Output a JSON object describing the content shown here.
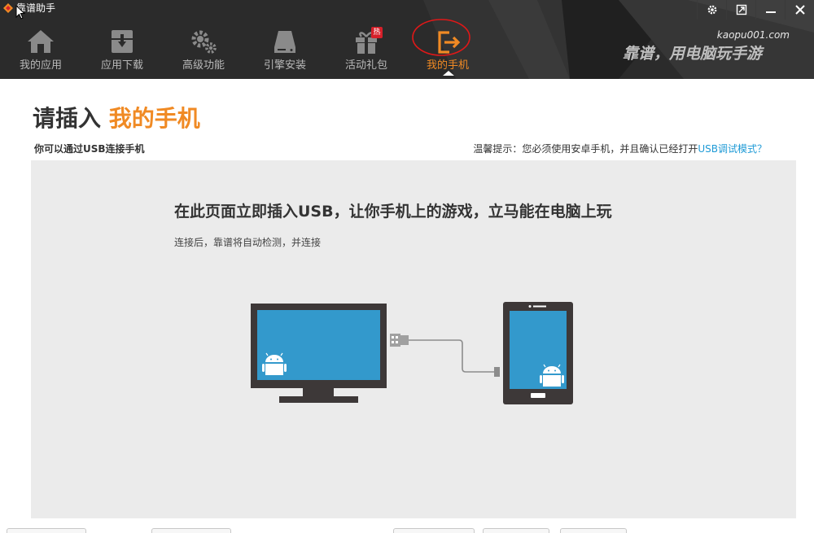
{
  "app": {
    "title": "靠谱助手"
  },
  "window_controls": [
    {
      "name": "settings-icon"
    },
    {
      "name": "restore-icon"
    },
    {
      "name": "minimize-icon"
    },
    {
      "name": "close-icon"
    }
  ],
  "nav": {
    "items": [
      {
        "label": "我的应用",
        "icon": "home-icon"
      },
      {
        "label": "应用下载",
        "icon": "download-icon"
      },
      {
        "label": "高级功能",
        "icon": "gears-icon"
      },
      {
        "label": "引擎安装",
        "icon": "disk-icon"
      },
      {
        "label": "活动礼包",
        "icon": "gift-icon",
        "badge": "热"
      },
      {
        "label": "我的手机",
        "icon": "phone-exit-icon",
        "active": true
      }
    ]
  },
  "brand": {
    "url": "kaopu001.com",
    "slogan": "靠谱，用电脑玩手游"
  },
  "main": {
    "title_prefix": "请插入",
    "title_highlight": "我的手机",
    "subtitle": "你可以通过USB连接手机",
    "tip_text": "温馨提示：您必须使用安卓手机，并且确认已经打开",
    "tip_link": "USB调试模式？",
    "panel_heading": "在此页面立即插入USB，让你手机上的游戏，立马能在电脑上玩",
    "panel_sub": "连接后，靠谱将自动检测，并连接"
  },
  "colors": {
    "topbar": "#2b2b2b",
    "accent": "#f08a24",
    "link": "#1e9ad6",
    "screen": "#3399cc",
    "device": "#3d3838",
    "android": "#ffffff",
    "hot": "#d6202a"
  }
}
